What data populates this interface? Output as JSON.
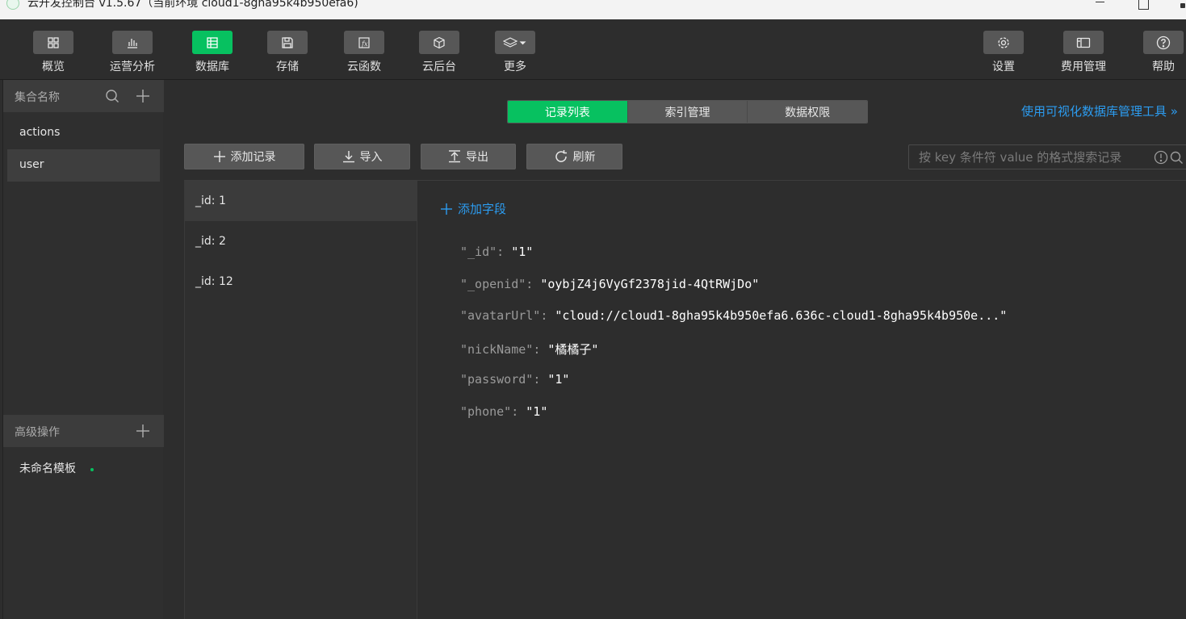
{
  "window": {
    "title": "云开发控制台 v1.5.67（当前环境 cloud1-8gha95k4b950efa6)"
  },
  "toolbar": {
    "items": [
      {
        "label": "概览",
        "icon": "grid-icon"
      },
      {
        "label": "运营分析",
        "icon": "bar-chart-icon"
      },
      {
        "label": "数据库",
        "icon": "database-icon"
      },
      {
        "label": "存储",
        "icon": "storage-icon"
      },
      {
        "label": "云函数",
        "icon": "function-icon"
      },
      {
        "label": "云后台",
        "icon": "cube-icon"
      },
      {
        "label": "更多",
        "icon": "layers-icon"
      }
    ],
    "right_items": [
      {
        "label": "设置",
        "icon": "gear-icon"
      },
      {
        "label": "费用管理",
        "icon": "billing-icon"
      },
      {
        "label": "帮助",
        "icon": "help-icon"
      }
    ],
    "active_index": 2,
    "accent_color": "#07c160"
  },
  "sidebar": {
    "collections_header": "集合名称",
    "collections": [
      "actions",
      "user"
    ],
    "selected_collection": "user",
    "advanced_header": "高级操作",
    "templates": [
      "未命名模板"
    ]
  },
  "main": {
    "tabs": [
      "记录列表",
      "索引管理",
      "数据权限"
    ],
    "active_tab": "记录列表",
    "visual_tool_link": "使用可视化数据库管理工具 »",
    "actions": {
      "add_record": "添加记录",
      "import": "导入",
      "export": "导出",
      "refresh": "刷新"
    },
    "search": {
      "placeholder": "按 key 条件符 value 的格式搜索记录"
    },
    "records": [
      "_id: 1",
      "_id: 2",
      "_id: 12"
    ],
    "selected_record": "_id: 1",
    "detail": {
      "add_field_label": "添加字段",
      "fields": [
        {
          "key": "\"_id\"",
          "value": "\"1\""
        },
        {
          "key": "\"_openid\"",
          "value": "\"oybjZ4j6VyGf2378jid-4QtRWjDo\""
        },
        {
          "key": "\"avatarUrl\"",
          "value": "\"cloud://cloud1-8gha95k4b950efa6.636c-cloud1-8gha95k4b950e...\""
        },
        {
          "key": "\"nickName\"",
          "value": "\"橘橘子\""
        },
        {
          "key": "\"password\"",
          "value": "\"1\""
        },
        {
          "key": "\"phone\"",
          "value": "\"1\""
        }
      ]
    }
  },
  "colors": {
    "accent": "#07c160",
    "link": "#2c9cf0",
    "background": "#2d2d2d"
  }
}
